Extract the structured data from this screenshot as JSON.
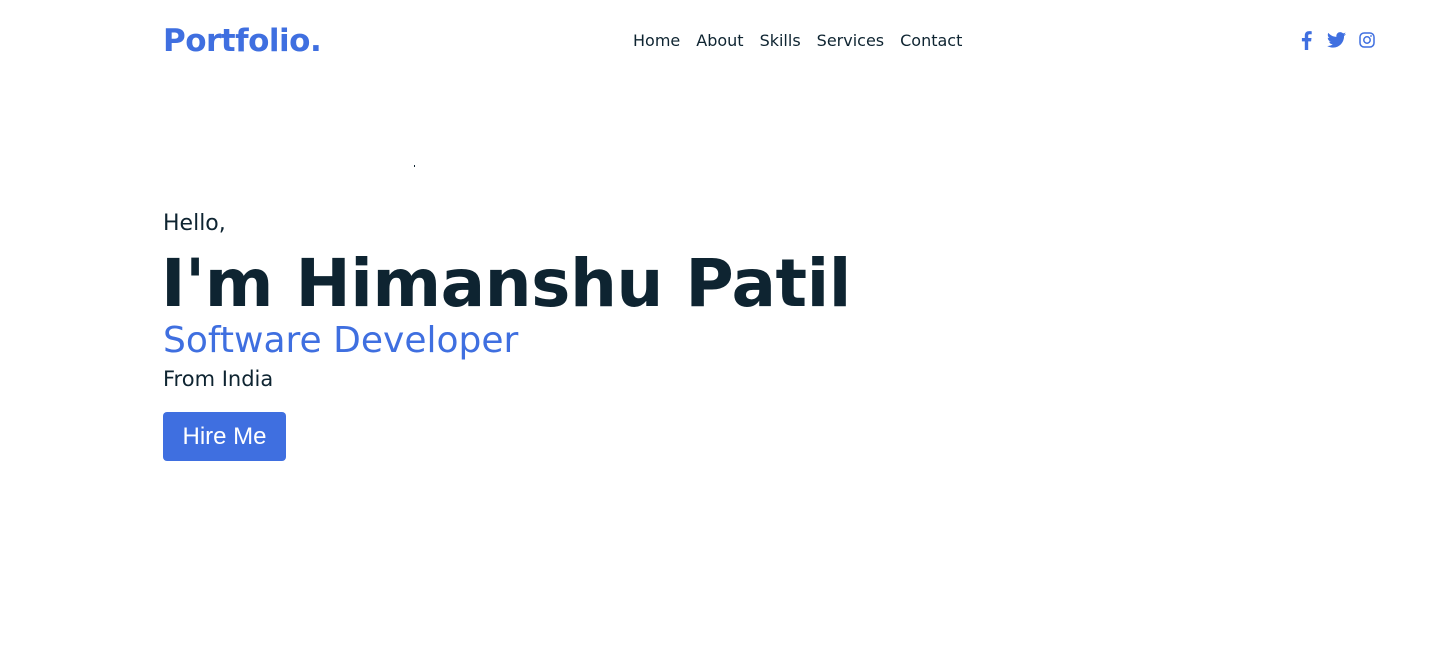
{
  "header": {
    "logo": "Portfolio.",
    "nav": [
      {
        "label": "Home"
      },
      {
        "label": "About"
      },
      {
        "label": "Skills"
      },
      {
        "label": "Services"
      },
      {
        "label": "Contact"
      }
    ],
    "socials": [
      {
        "icon": "facebook-icon"
      },
      {
        "icon": "twitter-icon"
      },
      {
        "icon": "instagram-icon"
      }
    ]
  },
  "hero": {
    "greeting": "Hello,",
    "name": "I'm Himanshu Patil",
    "role": "Software Developer",
    "location": "From India",
    "cta_label": "Hire Me"
  },
  "colors": {
    "accent": "#3f6fe0",
    "text": "#0e2431",
    "background": "#ffffff"
  }
}
